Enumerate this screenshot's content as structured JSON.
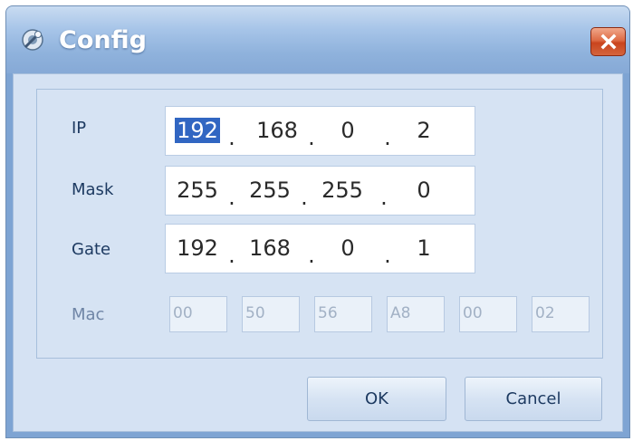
{
  "window": {
    "title": "Config",
    "icon": "settings-icon",
    "close_icon": "close-icon"
  },
  "fields": {
    "ip": {
      "label": "IP",
      "octets": [
        "192",
        "168",
        "0",
        "2"
      ]
    },
    "mask": {
      "label": "Mask",
      "octets": [
        "255",
        "255",
        "255",
        "0"
      ]
    },
    "gate": {
      "label": "Gate",
      "octets": [
        "192",
        "168",
        "0",
        "1"
      ]
    },
    "mac": {
      "label": "Mac",
      "parts": [
        "00",
        "50",
        "56",
        "A8",
        "00",
        "02"
      ]
    }
  },
  "separator": ".",
  "buttons": {
    "ok": "OK",
    "cancel": "Cancel"
  },
  "colors": {
    "titlebar": "#8fb2dc",
    "client": "#d5e2f3",
    "close_button": "#d4653d",
    "selection": "#3166c2"
  }
}
